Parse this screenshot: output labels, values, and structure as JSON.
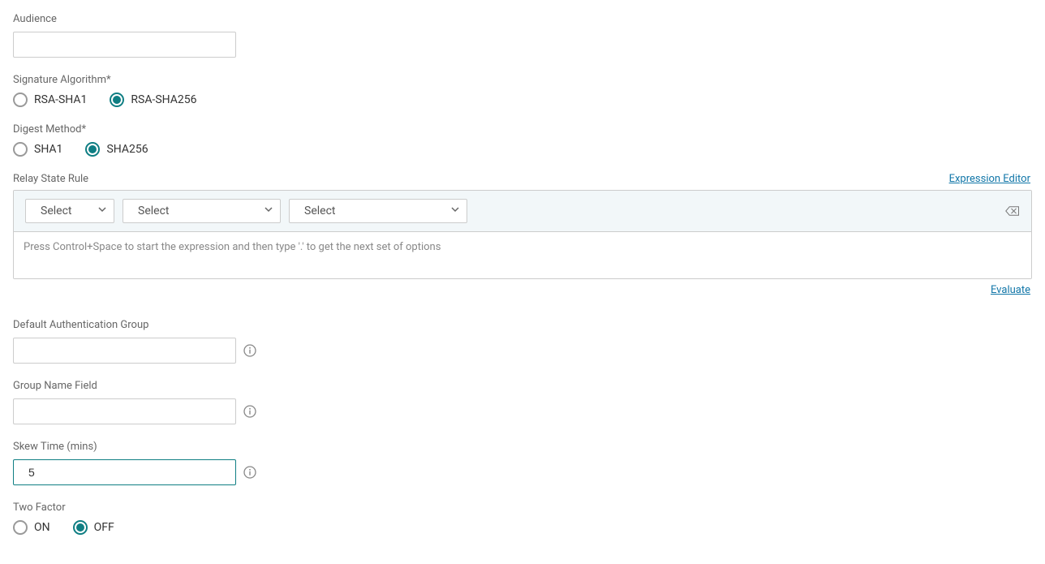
{
  "audience": {
    "label": "Audience",
    "value": ""
  },
  "signatureAlgorithm": {
    "label": "Signature Algorithm*",
    "options": {
      "rsaSha1": "RSA-SHA1",
      "rsaSha256": "RSA-SHA256"
    },
    "selected": "rsaSha256"
  },
  "digestMethod": {
    "label": "Digest Method*",
    "options": {
      "sha1": "SHA1",
      "sha256": "SHA256"
    },
    "selected": "sha256"
  },
  "relayStateRule": {
    "label": "Relay State Rule",
    "expressionEditorLink": "Expression Editor",
    "select1": "Select",
    "select2": "Select",
    "select3": "Select",
    "expressionPlaceholder": "Press Control+Space to start the expression and then type '.' to get the next set of options",
    "evaluateLink": "Evaluate"
  },
  "defaultAuthGroup": {
    "label": "Default Authentication Group",
    "value": ""
  },
  "groupNameField": {
    "label": "Group Name Field",
    "value": ""
  },
  "skewTime": {
    "label": "Skew Time (mins)",
    "value": "5"
  },
  "twoFactor": {
    "label": "Two Factor",
    "options": {
      "on": "ON",
      "off": "OFF"
    },
    "selected": "off"
  }
}
